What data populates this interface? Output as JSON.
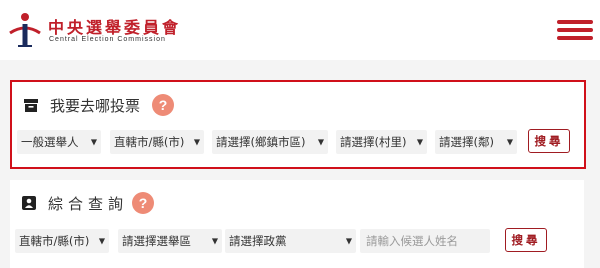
{
  "header": {
    "logo_title": "中央選舉委員會",
    "logo_subtitle": "Central Election Commission",
    "menu_icon": "hamburger-menu-icon",
    "brand_color": "#c0202a"
  },
  "voting_location": {
    "title": "我要去哪投票",
    "title_icon": "ballot-box-icon",
    "help_label": "?",
    "selects": [
      {
        "value": "一般選舉人"
      },
      {
        "value": "直轄市/縣(市)"
      },
      {
        "value": "請選擇(鄉鎮市區)"
      },
      {
        "value": "請選擇(村里)"
      },
      {
        "value": "請選擇(鄰)"
      }
    ],
    "search_label": "搜尋",
    "highlight_color": "#d0101a"
  },
  "general_query": {
    "title": "綜合查詢",
    "title_icon": "person-badge-icon",
    "help_label": "?",
    "selects": [
      {
        "value": "直轄市/縣(市)"
      },
      {
        "value": "請選擇選舉區"
      },
      {
        "value": "請選擇政黨"
      }
    ],
    "candidate_placeholder": "請輸入候選人姓名",
    "search_label": "搜尋"
  }
}
